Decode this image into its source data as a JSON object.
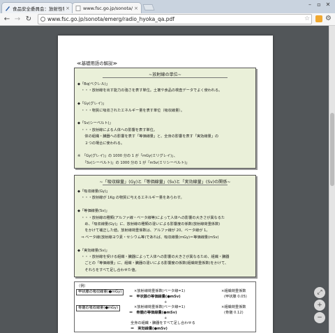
{
  "browser": {
    "tabs": [
      {
        "label": "食品安全委員会：放射性物"
      },
      {
        "label": "www.fsc.go.jp/sonota/e"
      }
    ],
    "url": "www.fsc.go.jp/sonota/emerg/radio_hyoka_qa.pdf"
  },
  "doc": {
    "section_heading": "≪基礎用語の解説≫",
    "panel1": {
      "title": "~放射線の単位~",
      "lines": [
        "◆「Bq(ベクレル)」",
        "　・・・放射線を出す能力の強さを表す単位。土壌や食品の検査データでよく使われる。",
        "",
        "◆「Gy(グレイ)」",
        "　・・・物質に吸収されたエネルギー量を表す単位（吸収線量）。",
        "",
        "◆「Sv(シーベルト)」",
        "　・・・放射線による人体への影響を表す単位。",
        "　　体の組織・臓器への影響を表す「等価線量」と、全身の影響を表す「実効線量」の",
        "　　２つの場合に使われる。",
        "",
        "※　「Gy(グレイ)」の 1000 分の 1 が「mGy(ミリグレイ)」、",
        "　　「Sv(シーベルト)」の 1000 分の 1 が「mSv(ミリシーベルト)」"
      ]
    },
    "panel2": {
      "title": "~「吸収線量」(Gy)と「等価線量」(Sv)と「実効線量」(Sv)の関係~",
      "lines": [
        "◆「吸収線量(Gy)」",
        "　・・・放射線が 1Kg の物質に与えるエネルギー量をあらわす。",
        "",
        "◆「等価線量(Sv)」",
        "　・・・放射線の種類(アルファ線・ベータ線等)によって人体への影響の大きさが異なるた",
        "　　め、「吸収線量(Gy)」に、放射線の種類の違いによる影響度の係数(放射線荷重係数)",
        "　　をかけて補正した値。放射線荷重係数は、アルファ線が 20、ベータ線が 1。",
        "　⇒ ベータ線(放射線ヨウ素・セシウム等)であれば、吸収線量(mGy)＝等価線量(mSv)",
        "",
        "◆「実効線量(Sv)」",
        "　・・・放射線を受ける組織・臓器によって人体への影響の大きさが異なるため、組織・臓器",
        "　　ごとの「等価線量」に、組織・臓器の違いによる影響度の係数(組織荷重係数)をかけて、",
        "　　それらをすべて足し合わせた値。"
      ]
    },
    "formula": {
      "example_label": "（例）",
      "row1_box": "甲状腺の吸収線量(●mGy)",
      "row1_mid": "×放射線荷重係数(ベータ線=1)",
      "row1_eq": "＝　甲状腺の等価線量(●mSv)",
      "row1_right": "×組織荷重係数",
      "row1_coef": "(甲状腺 0.05)",
      "plus1": "+",
      "row2_box": "骨髄の吸収線量(●mGy)",
      "row2_mid": "×放射線荷重係数(ベータ線=1)",
      "row2_eq": "＝　骨髄の等価線量(●mSv)",
      "row2_right": "×組織荷重係数",
      "row2_coef": "(骨髄 0.12)",
      "plus2": "+",
      "sum_text": "全身の組織・臓器をすべて足し合わせる",
      "result": "＝　実効線量(●mSv)"
    }
  }
}
